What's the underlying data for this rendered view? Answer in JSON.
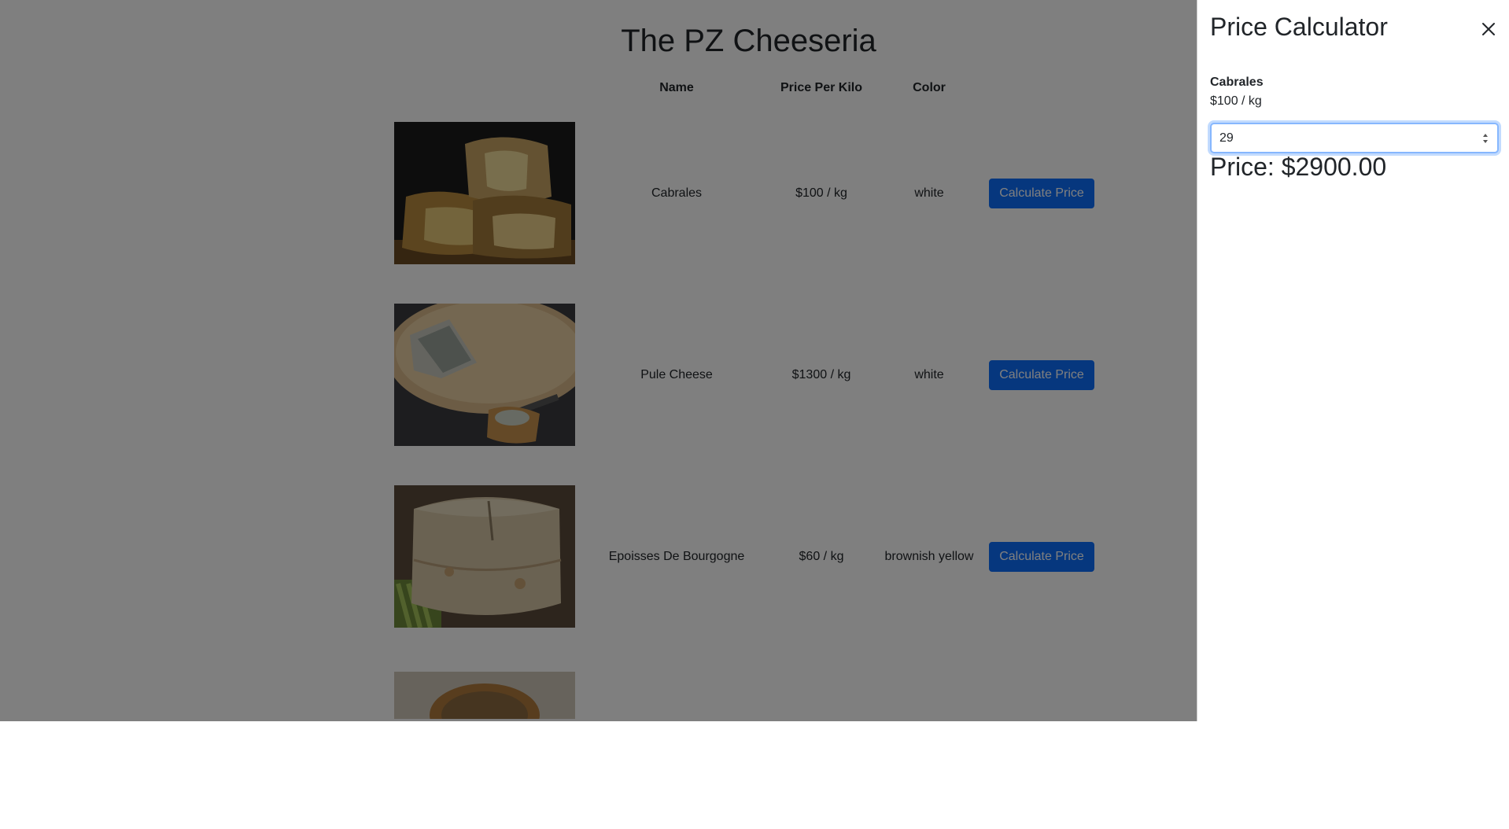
{
  "page": {
    "title": "The PZ Cheeseria"
  },
  "table": {
    "headers": {
      "name": "Name",
      "price": "Price Per Kilo",
      "color": "Color"
    },
    "rows": [
      {
        "name": "Cabrales",
        "price": "$100 / kg",
        "color": "white",
        "action": "Calculate Price"
      },
      {
        "name": "Pule Cheese",
        "price": "$1300 / kg",
        "color": "white",
        "action": "Calculate Price"
      },
      {
        "name": "Epoisses De Bourgogne",
        "price": "$60 / kg",
        "color": "brownish yellow",
        "action": "Calculate Price"
      }
    ]
  },
  "calculator": {
    "title": "Price Calculator",
    "cheese_name": "Cabrales",
    "cheese_price": "$100 / kg",
    "quantity": "29",
    "total": "Price: $2900.00"
  },
  "colors": {
    "primary": "#0d6efd",
    "backdrop": "rgba(0,0,0,0.5)"
  }
}
